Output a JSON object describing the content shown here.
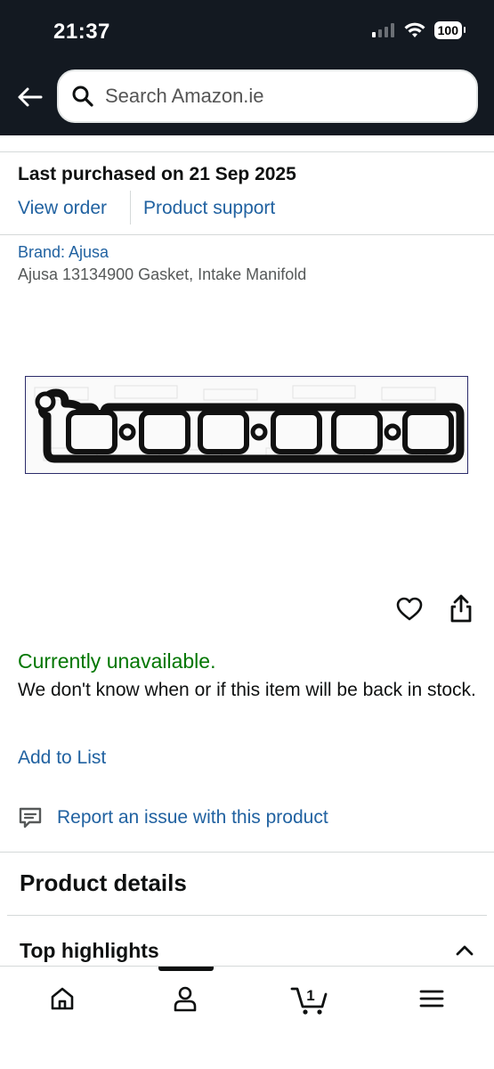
{
  "status_bar": {
    "time": "21:37",
    "battery": "100"
  },
  "search": {
    "placeholder": "Search Amazon.ie"
  },
  "purchase": {
    "last_purchased": "Last purchased on 21 Sep 2025",
    "view_order": "View order",
    "product_support": "Product support"
  },
  "product": {
    "brand": "Brand: Ajusa",
    "title": "Ajusa 13134900 Gasket, Intake Manifold"
  },
  "availability": {
    "status": "Currently unavailable.",
    "note": "We don't know when or if this item will be back in stock.",
    "add_to_list": "Add to List",
    "status_color": "#007600"
  },
  "report": {
    "label": "Report an issue with this product"
  },
  "sections": {
    "product_details": "Product details",
    "top_highlights": "Top highlights"
  },
  "nav": {
    "items": [
      "home-icon",
      "account-icon",
      "cart-icon",
      "menu-icon"
    ],
    "cart_count": "1"
  },
  "colors": {
    "header_bg": "#131921",
    "link": "#2162a1"
  }
}
